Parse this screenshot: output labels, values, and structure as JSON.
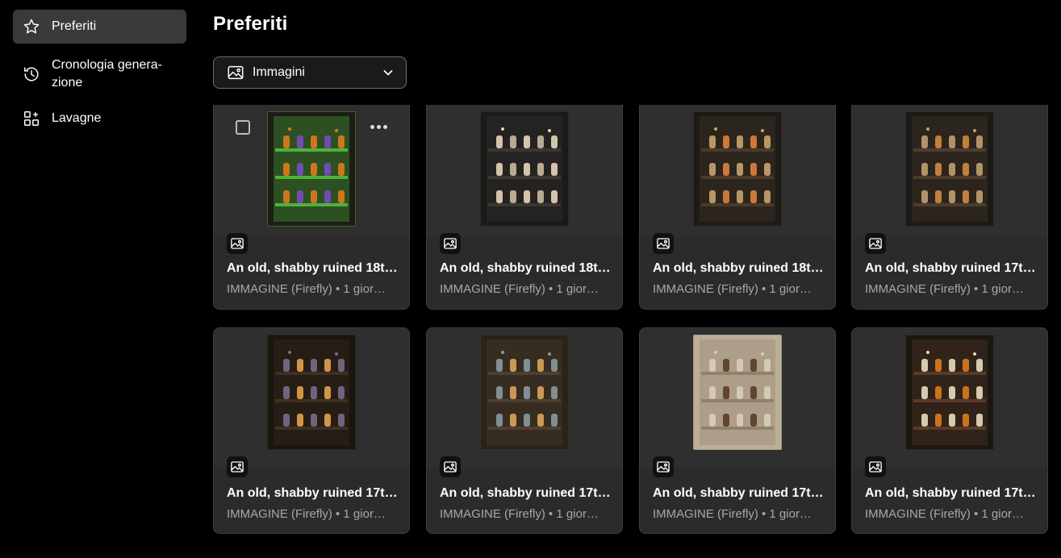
{
  "sidebar": {
    "items": [
      {
        "label": "Preferiti",
        "icon": "star-icon",
        "active": true
      },
      {
        "label": "Cronologia genera-\nzione",
        "icon": "history-icon",
        "active": false
      },
      {
        "label": "Lavagne",
        "icon": "boards-icon",
        "active": false
      }
    ]
  },
  "page": {
    "title": "Preferiti"
  },
  "filter": {
    "label": "Immagini",
    "icon": "image-icon"
  },
  "cards": [
    {
      "title": "An old, shabby ruined 18th…",
      "meta": "IMMAGINE (Firefly) • 1 gior…",
      "theme": [
        "#1c1d17",
        "#7a4ac0",
        "#4db33a",
        "#e07a1e"
      ]
    },
    {
      "title": "An old, shabby ruined 18th…",
      "meta": "IMMAGINE (Firefly) • 1 gior…",
      "theme": [
        "#1a1a19",
        "#c9b9a0",
        "#3a3731",
        "#e8d6b8"
      ]
    },
    {
      "title": "An old, shabby ruined 18th…",
      "meta": "IMMAGINE (Firefly) • 1 gior…",
      "theme": [
        "#1d1b18",
        "#e0813a",
        "#4a3a2a",
        "#c9a36b"
      ]
    },
    {
      "title": "An old, shabby ruined 17th…",
      "meta": "IMMAGINE (Firefly) • 1 gior…",
      "theme": [
        "#1b1a17",
        "#d58a3c",
        "#4d3c2c",
        "#bfa070"
      ]
    },
    {
      "title": "An old, shabby ruined 17th…",
      "meta": "IMMAGINE (Firefly) • 1 gior…",
      "theme": [
        "#19150f",
        "#e3a24b",
        "#3f3022",
        "#7a6a8c"
      ]
    },
    {
      "title": "An old, shabby ruined 17th…",
      "meta": "IMMAGINE (Firefly) • 1 gior…",
      "theme": [
        "#2a2319",
        "#dba55a",
        "#4d4030",
        "#8a9aa0"
      ]
    },
    {
      "title": "An old, shabby ruined 17th…",
      "meta": "IMMAGINE (Firefly) • 1 gior…",
      "theme": [
        "#bcae98",
        "#5a3a2a",
        "#8f826d",
        "#d8cdb8"
      ]
    },
    {
      "title": "An old, shabby ruined 17th…",
      "meta": "IMMAGINE (Firefly) • 1 gior…",
      "theme": [
        "#1b1712",
        "#e07a20",
        "#5a3a28",
        "#e8dcc0"
      ]
    }
  ],
  "card_actions": {
    "checkbox": "select-checkbox",
    "more": "more-options-icon"
  }
}
